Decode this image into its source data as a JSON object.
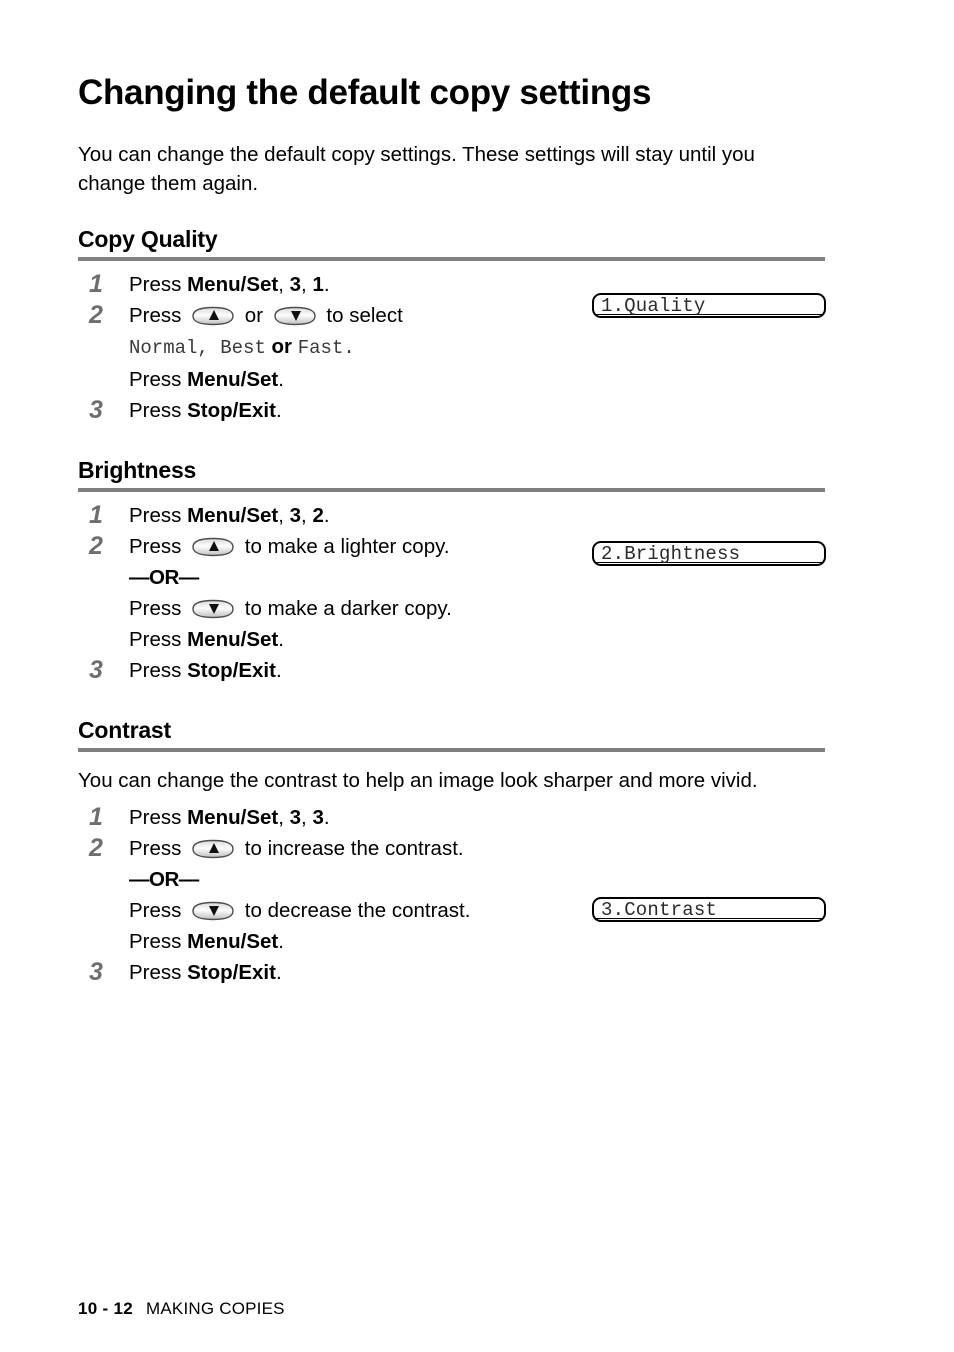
{
  "page": {
    "title": "Changing the default copy settings",
    "intro": "You can change the default copy settings. These settings will stay until you change them again."
  },
  "sections": [
    {
      "heading": "Copy Quality",
      "lcd": "1.Quality",
      "steps": [
        {
          "num": "1",
          "lines": [
            {
              "prefix": "Press ",
              "bold1": "Menu/Set",
              "mid": ", ",
              "bold2": "3",
              "mid2": ", ",
              "bold3": "1",
              "suffix": "."
            }
          ]
        },
        {
          "num": "2",
          "lines": [
            {
              "text_before": "Press ",
              "key1": "up-arrow-key",
              "between": " or ",
              "key2": "down-arrow-key",
              "text_after": " to select"
            },
            {
              "mono1": "Normal",
              "comma": ", ",
              "mono2": "Best",
              "orword": " or ",
              "mono3": "Fast",
              "period": "."
            },
            {
              "prefix": "Press ",
              "bold1": "Menu/Set",
              "suffix": "."
            }
          ]
        },
        {
          "num": "3",
          "lines": [
            {
              "prefix": "Press ",
              "bold1": "Stop/Exit",
              "suffix": "."
            }
          ]
        }
      ]
    },
    {
      "heading": "Brightness",
      "lcd": "2.Brightness",
      "steps": [
        {
          "num": "1",
          "lines": [
            {
              "prefix": "Press ",
              "bold1": "Menu/Set",
              "mid": ", ",
              "bold2": "3",
              "mid2": ", ",
              "bold3": "2",
              "suffix": "."
            }
          ]
        },
        {
          "num": "2",
          "lines": [
            {
              "text_before": "Press ",
              "key1": "up-arrow-key",
              "text_after": " to make a lighter copy."
            },
            {
              "or_separator": "—OR—"
            },
            {
              "text_before": "Press ",
              "key1": "down-arrow-key",
              "text_after": " to make a darker copy."
            },
            {
              "prefix": "Press ",
              "bold1": "Menu/Set",
              "suffix": "."
            }
          ]
        },
        {
          "num": "3",
          "lines": [
            {
              "prefix": "Press ",
              "bold1": "Stop/Exit",
              "suffix": "."
            }
          ]
        }
      ]
    },
    {
      "heading": "Contrast",
      "lcd": "3.Contrast",
      "intro": "You can change the contrast to help an image look sharper and more vivid.",
      "steps": [
        {
          "num": "1",
          "lines": [
            {
              "prefix": "Press ",
              "bold1": "Menu/Set",
              "mid": ", ",
              "bold2": "3",
              "mid2": ", ",
              "bold3": "3",
              "suffix": "."
            }
          ]
        },
        {
          "num": "2",
          "lines": [
            {
              "text_before": "Press ",
              "key1": "up-arrow-key",
              "text_after": " to increase the contrast."
            },
            {
              "or_separator": "—OR—"
            },
            {
              "text_before": "Press ",
              "key1": "down-arrow-key",
              "text_after": " to decrease the contrast."
            },
            {
              "prefix": "Press ",
              "bold1": "Menu/Set",
              "suffix": "."
            }
          ]
        },
        {
          "num": "3",
          "lines": [
            {
              "prefix": "Press ",
              "bold1": "Stop/Exit",
              "suffix": "."
            }
          ]
        }
      ]
    }
  ],
  "footer": {
    "page_number": "10 - 12",
    "section_name": "MAKING COPIES"
  },
  "colors": {
    "rule": "#808080",
    "step_number": "#6e6e6e",
    "mono_text": "#3a3a3a",
    "text": "#000000",
    "background": "#ffffff"
  }
}
